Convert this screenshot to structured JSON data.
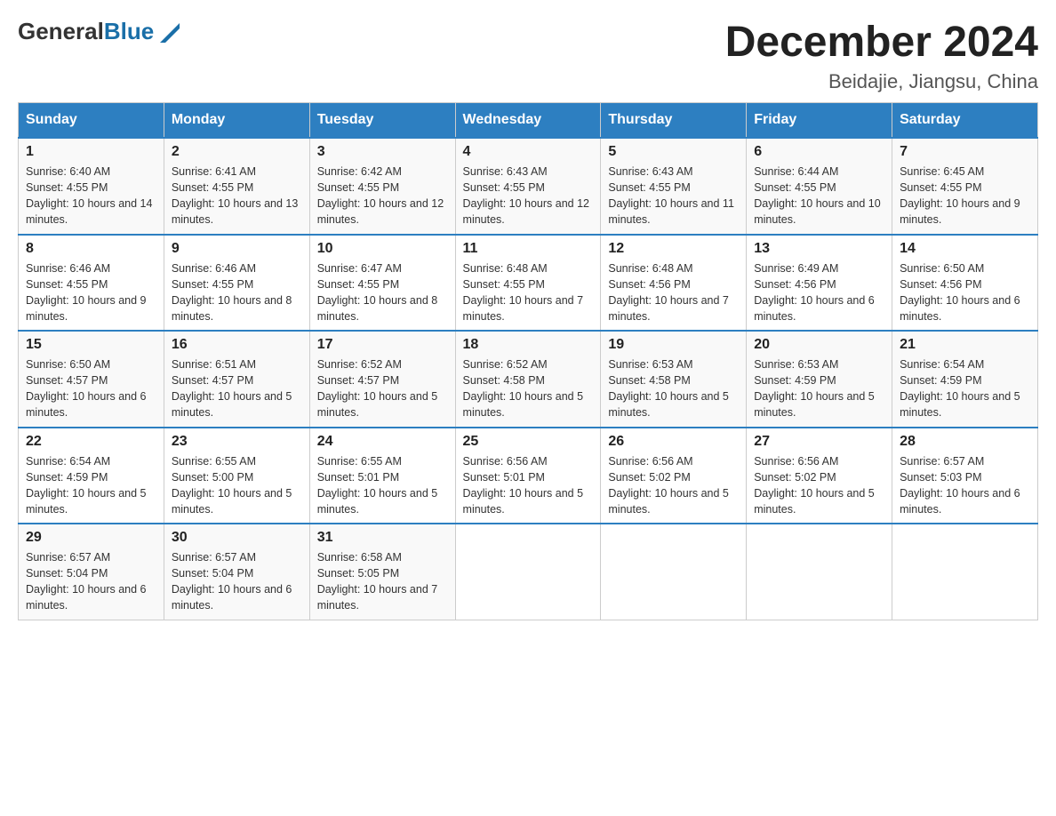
{
  "header": {
    "logo_general": "General",
    "logo_blue": "Blue",
    "title": "December 2024",
    "subtitle": "Beidajie, Jiangsu, China"
  },
  "weekdays": [
    "Sunday",
    "Monday",
    "Tuesday",
    "Wednesday",
    "Thursday",
    "Friday",
    "Saturday"
  ],
  "weeks": [
    [
      {
        "day": "1",
        "sunrise": "6:40 AM",
        "sunset": "4:55 PM",
        "daylight": "10 hours and 14 minutes."
      },
      {
        "day": "2",
        "sunrise": "6:41 AM",
        "sunset": "4:55 PM",
        "daylight": "10 hours and 13 minutes."
      },
      {
        "day": "3",
        "sunrise": "6:42 AM",
        "sunset": "4:55 PM",
        "daylight": "10 hours and 12 minutes."
      },
      {
        "day": "4",
        "sunrise": "6:43 AM",
        "sunset": "4:55 PM",
        "daylight": "10 hours and 12 minutes."
      },
      {
        "day": "5",
        "sunrise": "6:43 AM",
        "sunset": "4:55 PM",
        "daylight": "10 hours and 11 minutes."
      },
      {
        "day": "6",
        "sunrise": "6:44 AM",
        "sunset": "4:55 PM",
        "daylight": "10 hours and 10 minutes."
      },
      {
        "day": "7",
        "sunrise": "6:45 AM",
        "sunset": "4:55 PM",
        "daylight": "10 hours and 9 minutes."
      }
    ],
    [
      {
        "day": "8",
        "sunrise": "6:46 AM",
        "sunset": "4:55 PM",
        "daylight": "10 hours and 9 minutes."
      },
      {
        "day": "9",
        "sunrise": "6:46 AM",
        "sunset": "4:55 PM",
        "daylight": "10 hours and 8 minutes."
      },
      {
        "day": "10",
        "sunrise": "6:47 AM",
        "sunset": "4:55 PM",
        "daylight": "10 hours and 8 minutes."
      },
      {
        "day": "11",
        "sunrise": "6:48 AM",
        "sunset": "4:55 PM",
        "daylight": "10 hours and 7 minutes."
      },
      {
        "day": "12",
        "sunrise": "6:48 AM",
        "sunset": "4:56 PM",
        "daylight": "10 hours and 7 minutes."
      },
      {
        "day": "13",
        "sunrise": "6:49 AM",
        "sunset": "4:56 PM",
        "daylight": "10 hours and 6 minutes."
      },
      {
        "day": "14",
        "sunrise": "6:50 AM",
        "sunset": "4:56 PM",
        "daylight": "10 hours and 6 minutes."
      }
    ],
    [
      {
        "day": "15",
        "sunrise": "6:50 AM",
        "sunset": "4:57 PM",
        "daylight": "10 hours and 6 minutes."
      },
      {
        "day": "16",
        "sunrise": "6:51 AM",
        "sunset": "4:57 PM",
        "daylight": "10 hours and 5 minutes."
      },
      {
        "day": "17",
        "sunrise": "6:52 AM",
        "sunset": "4:57 PM",
        "daylight": "10 hours and 5 minutes."
      },
      {
        "day": "18",
        "sunrise": "6:52 AM",
        "sunset": "4:58 PM",
        "daylight": "10 hours and 5 minutes."
      },
      {
        "day": "19",
        "sunrise": "6:53 AM",
        "sunset": "4:58 PM",
        "daylight": "10 hours and 5 minutes."
      },
      {
        "day": "20",
        "sunrise": "6:53 AM",
        "sunset": "4:59 PM",
        "daylight": "10 hours and 5 minutes."
      },
      {
        "day": "21",
        "sunrise": "6:54 AM",
        "sunset": "4:59 PM",
        "daylight": "10 hours and 5 minutes."
      }
    ],
    [
      {
        "day": "22",
        "sunrise": "6:54 AM",
        "sunset": "4:59 PM",
        "daylight": "10 hours and 5 minutes."
      },
      {
        "day": "23",
        "sunrise": "6:55 AM",
        "sunset": "5:00 PM",
        "daylight": "10 hours and 5 minutes."
      },
      {
        "day": "24",
        "sunrise": "6:55 AM",
        "sunset": "5:01 PM",
        "daylight": "10 hours and 5 minutes."
      },
      {
        "day": "25",
        "sunrise": "6:56 AM",
        "sunset": "5:01 PM",
        "daylight": "10 hours and 5 minutes."
      },
      {
        "day": "26",
        "sunrise": "6:56 AM",
        "sunset": "5:02 PM",
        "daylight": "10 hours and 5 minutes."
      },
      {
        "day": "27",
        "sunrise": "6:56 AM",
        "sunset": "5:02 PM",
        "daylight": "10 hours and 5 minutes."
      },
      {
        "day": "28",
        "sunrise": "6:57 AM",
        "sunset": "5:03 PM",
        "daylight": "10 hours and 6 minutes."
      }
    ],
    [
      {
        "day": "29",
        "sunrise": "6:57 AM",
        "sunset": "5:04 PM",
        "daylight": "10 hours and 6 minutes."
      },
      {
        "day": "30",
        "sunrise": "6:57 AM",
        "sunset": "5:04 PM",
        "daylight": "10 hours and 6 minutes."
      },
      {
        "day": "31",
        "sunrise": "6:58 AM",
        "sunset": "5:05 PM",
        "daylight": "10 hours and 7 minutes."
      },
      null,
      null,
      null,
      null
    ]
  ]
}
